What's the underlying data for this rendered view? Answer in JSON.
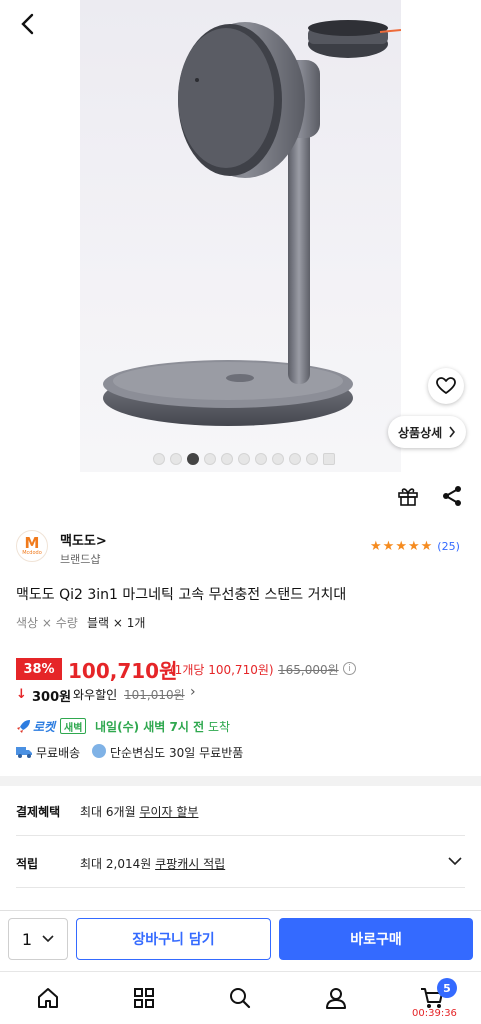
{
  "hero": {
    "detail_label": "상품상세",
    "image_count": 10,
    "active_index": 3
  },
  "brand": {
    "name": "맥도도>",
    "shop_label": "브랜드샵",
    "rating_stars": 5,
    "review_count": "(25)"
  },
  "product": {
    "title": "맥도도 Qi2 3in1 마그네틱 고속 무선충전 스탠드 거치대",
    "option_label": "색상 × 수량",
    "option_value": "블랙 × 1개"
  },
  "price": {
    "discount": "38%",
    "sale_price": "100,710원",
    "unit_price": "(1개당 100,710원)",
    "original_price": "165,000원",
    "wow_discount": "300원",
    "wow_label": "와우할인",
    "wow_original": "101,010원"
  },
  "delivery": {
    "rocket_label": "로켓",
    "dawn_badge": "새벽",
    "arrival": "내일(수) 새벽 7시 전",
    "arrival_suffix": " 도착",
    "free_shipping": "무료배송",
    "returns": "단순변심도 30일 무료반품"
  },
  "benefits": {
    "payment_label": "결제혜택",
    "payment_prefix": "최대 6개월 ",
    "payment_link": "무이자 할부",
    "points_label": "적립",
    "points_prefix": "최대 2,014원 ",
    "points_link": "쿠팡캐시 적립"
  },
  "actions": {
    "quantity": "1",
    "cart_label": "장바구니 담기",
    "buy_label": "바로구매"
  },
  "nav": {
    "cart_count": "5",
    "timer": "00:39:36"
  },
  "colors": {
    "accent": "#346aff",
    "sale": "#e52528",
    "rocket_green": "#2fa84f"
  }
}
